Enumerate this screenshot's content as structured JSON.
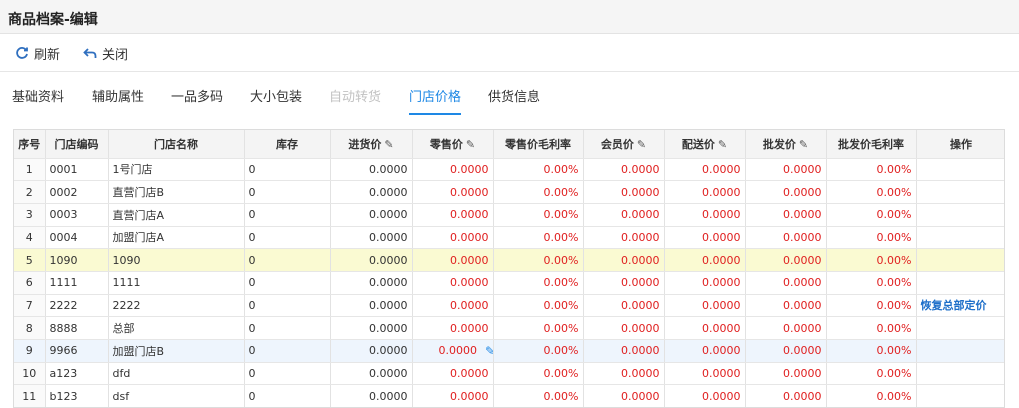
{
  "window": {
    "title": "商品档案-编辑"
  },
  "toolbar": {
    "refresh_label": "刷新",
    "close_label": "关闭",
    "refresh_icon": "refresh-icon",
    "close_icon": "back-arrow-icon"
  },
  "tabs": [
    {
      "label": "基础资料",
      "state": "normal"
    },
    {
      "label": "辅助属性",
      "state": "normal"
    },
    {
      "label": "一品多码",
      "state": "normal"
    },
    {
      "label": "大小包装",
      "state": "normal"
    },
    {
      "label": "自动转货",
      "state": "disabled"
    },
    {
      "label": "门店价格",
      "state": "active"
    },
    {
      "label": "供货信息",
      "state": "normal"
    }
  ],
  "table": {
    "columns": [
      "序号",
      "门店编码",
      "门店名称",
      "库存",
      "进货价",
      "零售价",
      "零售价毛利率",
      "会员价",
      "配送价",
      "批发价",
      "批发价毛利率",
      "操作"
    ],
    "editable_columns": [
      "进货价",
      "零售价",
      "会员价",
      "配送价",
      "批发价"
    ],
    "rows": [
      {
        "no": "1",
        "code": "0001",
        "name": "1号门店",
        "stock": "0",
        "purchase": "0.0000",
        "retail": "0.0000",
        "retail_margin": "0.00%",
        "member": "0.0000",
        "delivery": "0.0000",
        "wholesale": "0.0000",
        "wholesale_margin": "0.00%",
        "action": ""
      },
      {
        "no": "2",
        "code": "0002",
        "name": "直营门店B",
        "stock": "0",
        "purchase": "0.0000",
        "retail": "0.0000",
        "retail_margin": "0.00%",
        "member": "0.0000",
        "delivery": "0.0000",
        "wholesale": "0.0000",
        "wholesale_margin": "0.00%",
        "action": ""
      },
      {
        "no": "3",
        "code": "0003",
        "name": "直营门店A",
        "stock": "0",
        "purchase": "0.0000",
        "retail": "0.0000",
        "retail_margin": "0.00%",
        "member": "0.0000",
        "delivery": "0.0000",
        "wholesale": "0.0000",
        "wholesale_margin": "0.00%",
        "action": ""
      },
      {
        "no": "4",
        "code": "0004",
        "name": "加盟门店A",
        "stock": "0",
        "purchase": "0.0000",
        "retail": "0.0000",
        "retail_margin": "0.00%",
        "member": "0.0000",
        "delivery": "0.0000",
        "wholesale": "0.0000",
        "wholesale_margin": "0.00%",
        "action": ""
      },
      {
        "no": "5",
        "code": "1090",
        "name": "1090",
        "stock": "0",
        "purchase": "0.0000",
        "retail": "0.0000",
        "retail_margin": "0.00%",
        "member": "0.0000",
        "delivery": "0.0000",
        "wholesale": "0.0000",
        "wholesale_margin": "0.00%",
        "action": "",
        "state": "highlight"
      },
      {
        "no": "6",
        "code": "1111",
        "name": "1111",
        "stock": "0",
        "purchase": "0.0000",
        "retail": "0.0000",
        "retail_margin": "0.00%",
        "member": "0.0000",
        "delivery": "0.0000",
        "wholesale": "0.0000",
        "wholesale_margin": "0.00%",
        "action": ""
      },
      {
        "no": "7",
        "code": "2222",
        "name": "2222",
        "stock": "0",
        "purchase": "0.0000",
        "retail": "0.0000",
        "retail_margin": "0.00%",
        "member": "0.0000",
        "delivery": "0.0000",
        "wholesale": "0.0000",
        "wholesale_margin": "0.00%",
        "action": "恢复总部定价"
      },
      {
        "no": "8",
        "code": "8888",
        "name": "总部",
        "stock": "0",
        "purchase": "0.0000",
        "retail": "0.0000",
        "retail_margin": "0.00%",
        "member": "0.0000",
        "delivery": "0.0000",
        "wholesale": "0.0000",
        "wholesale_margin": "0.00%",
        "action": ""
      },
      {
        "no": "9",
        "code": "9966",
        "name": "加盟门店B",
        "stock": "0",
        "purchase": "0.0000",
        "retail": "0.0000",
        "retail_margin": "0.00%",
        "member": "0.0000",
        "delivery": "0.0000",
        "wholesale": "0.0000",
        "wholesale_margin": "0.00%",
        "action": "",
        "state": "editing"
      },
      {
        "no": "10",
        "code": "a123",
        "name": "dfd",
        "stock": "0",
        "purchase": "0.0000",
        "retail": "0.0000",
        "retail_margin": "0.00%",
        "member": "0.0000",
        "delivery": "0.0000",
        "wholesale": "0.0000",
        "wholesale_margin": "0.00%",
        "action": ""
      },
      {
        "no": "11",
        "code": "b123",
        "name": "dsf",
        "stock": "0",
        "purchase": "0.0000",
        "retail": "0.0000",
        "retail_margin": "0.00%",
        "member": "0.0000",
        "delivery": "0.0000",
        "wholesale": "0.0000",
        "wholesale_margin": "0.00%",
        "action": ""
      }
    ]
  },
  "colors": {
    "accent": "#1e88e5",
    "value_red": "#e02020",
    "highlight_row": "#fafad2",
    "editing_row": "#eef5fd"
  }
}
